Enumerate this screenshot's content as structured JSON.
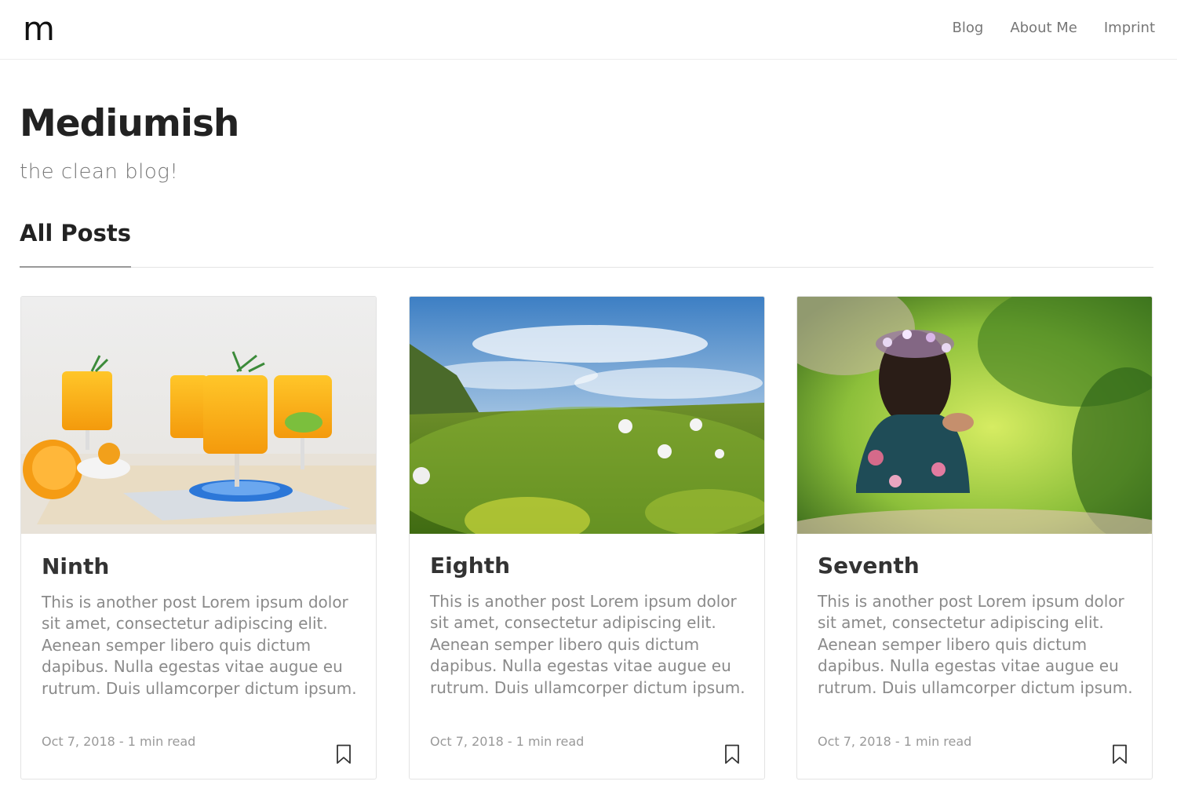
{
  "navbar": {
    "logo": "m",
    "links": [
      "Blog",
      "About Me",
      "Imprint"
    ]
  },
  "header": {
    "title": "Mediumish",
    "subtitle": "the clean blog!"
  },
  "section": {
    "heading": "All Posts"
  },
  "posts": [
    {
      "title": "Ninth",
      "excerpt": "This is another post Lorem ipsum dolor sit amet, consectetur adipiscing elit. Aenean semper libero quis dictum dapibus. Nulla egestas vitae augue eu rutrum. Duis ullamcorper dictum ipsum.",
      "meta": "Oct 7, 2018 - 1 min read",
      "image": "orange-juice-glasses-photo"
    },
    {
      "title": "Eighth",
      "excerpt": "This is another post Lorem ipsum dolor sit amet, consectetur adipiscing elit. Aenean semper libero quis dictum dapibus. Nulla egestas vitae augue eu rutrum. Duis ullamcorper dictum ipsum.",
      "meta": "Oct 7, 2018 - 1 min read",
      "image": "dandelion-meadow-sunset-photo"
    },
    {
      "title": "Seventh",
      "excerpt": "This is another post Lorem ipsum dolor sit amet, consectetur adipiscing elit. Aenean semper libero quis dictum dapibus. Nulla egestas vitae augue eu rutrum. Duis ullamcorper dictum ipsum.",
      "meta": "Oct 7, 2018 - 1 min read",
      "image": "girl-flower-crown-photo"
    }
  ],
  "icons": {
    "bookmark": "bookmark-icon"
  }
}
